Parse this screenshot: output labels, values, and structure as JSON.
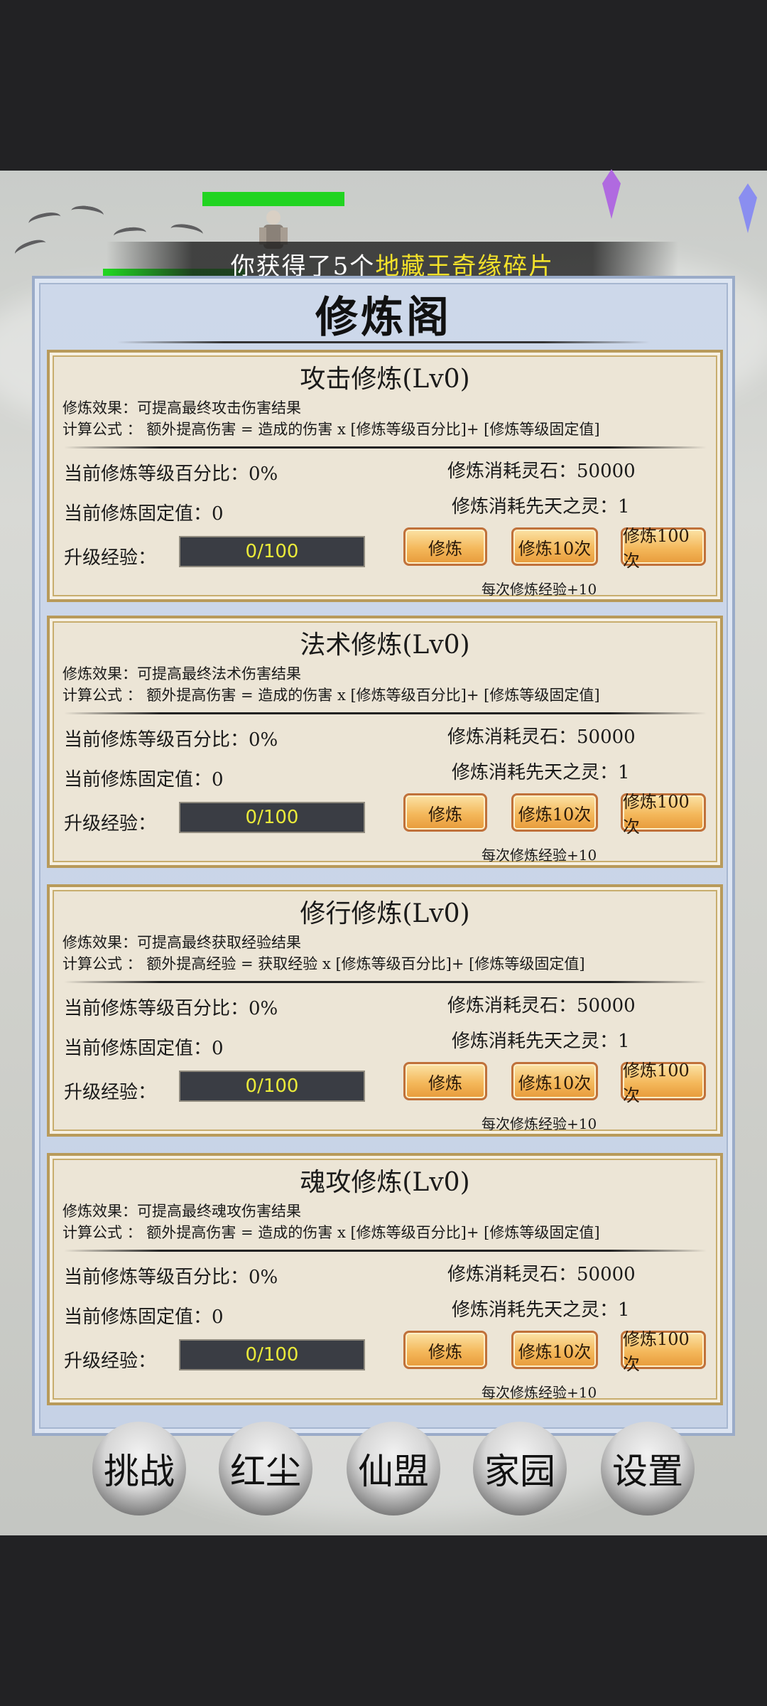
{
  "notice": {
    "prefix": "你获得了5个",
    "highlight": "地藏王奇缘碎片"
  },
  "panel": {
    "title": "修炼阁"
  },
  "cards": [
    {
      "title": "攻击修炼(Lv0)",
      "effect": "修炼效果：可提高最终攻击伤害结果",
      "formula": "计算公式 ： 额外提高伤害 = 造成的伤害 x [修炼等级百分比]+ [修炼等级固定值]",
      "pct": "当前修炼等级百分比：0%",
      "fixed": "当前修炼固定值：0",
      "cost_stone": "修炼消耗灵石：50000",
      "cost_spirit": "修炼消耗先天之灵：1",
      "exp_label": "升级经验：",
      "exp_value": "0/100",
      "btn1": "修炼",
      "btn10": "修炼10次",
      "btn100": "修炼100次",
      "note": "每次修炼经验+10"
    },
    {
      "title": "法术修炼(Lv0)",
      "effect": "修炼效果：可提高最终法术伤害结果",
      "formula": "计算公式 ： 额外提高伤害 = 造成的伤害 x [修炼等级百分比]+ [修炼等级固定值]",
      "pct": "当前修炼等级百分比：0%",
      "fixed": "当前修炼固定值：0",
      "cost_stone": "修炼消耗灵石：50000",
      "cost_spirit": "修炼消耗先天之灵：1",
      "exp_label": "升级经验：",
      "exp_value": "0/100",
      "btn1": "修炼",
      "btn10": "修炼10次",
      "btn100": "修炼100次",
      "note": "每次修炼经验+10"
    },
    {
      "title": "修行修炼(Lv0)",
      "effect": "修炼效果：可提高最终获取经验结果",
      "formula": "计算公式 ： 额外提高经验 = 获取经验 x [修炼等级百分比]+ [修炼等级固定值]",
      "pct": "当前修炼等级百分比：0%",
      "fixed": "当前修炼固定值：0",
      "cost_stone": "修炼消耗灵石：50000",
      "cost_spirit": "修炼消耗先天之灵：1",
      "exp_label": "升级经验：",
      "exp_value": "0/100",
      "btn1": "修炼",
      "btn10": "修炼10次",
      "btn100": "修炼100次",
      "note": "每次修炼经验+10"
    },
    {
      "title": "魂攻修炼(Lv0)",
      "effect": "修炼效果：可提高最终魂攻伤害结果",
      "formula": "计算公式 ： 额外提高伤害 = 造成的伤害 x [修炼等级百分比]+ [修炼等级固定值]",
      "pct": "当前修炼等级百分比：0%",
      "fixed": "当前修炼固定值：0",
      "cost_stone": "修炼消耗灵石：50000",
      "cost_spirit": "修炼消耗先天之灵：1",
      "exp_label": "升级经验：",
      "exp_value": "0/100",
      "btn1": "修炼",
      "btn10": "修炼10次",
      "btn100": "修炼100次",
      "note": "每次修炼经验+10"
    }
  ],
  "nav": {
    "challenge": "挑战",
    "hongchen": "红尘",
    "xianmeng": "仙盟",
    "home": "家园",
    "settings": "设置"
  },
  "colors": {
    "hp": "#21d421",
    "highlight": "#f2e12a",
    "button": "#f4b85b",
    "exp_text": "#eaea3a"
  }
}
